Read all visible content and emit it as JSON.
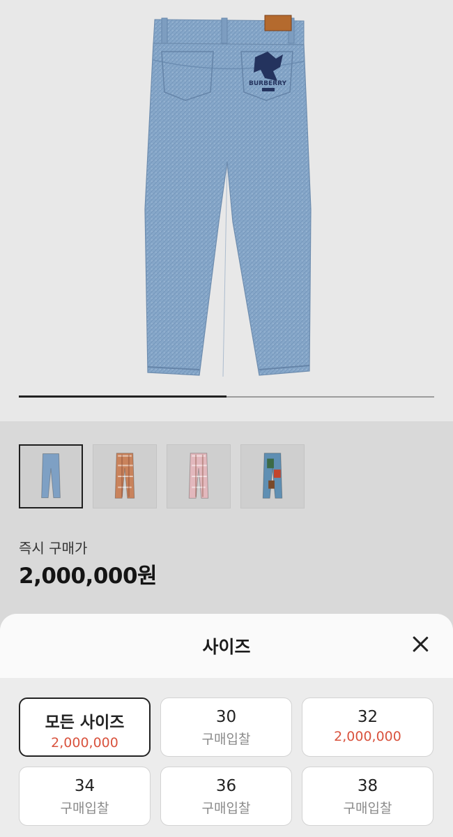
{
  "product": {
    "brand_mark": "BURBERRY",
    "hero_progress": 0.5
  },
  "gallery": {
    "thumbnails": [
      {
        "name": "thumb-blue-denim",
        "color": "#7ea0c4",
        "selected": true
      },
      {
        "name": "thumb-plaid-orange",
        "color": "#c9835c",
        "selected": false
      },
      {
        "name": "thumb-plaid-pink",
        "color": "#e2b8bd",
        "selected": false
      },
      {
        "name": "thumb-patchwork",
        "color": "#5f8fb3",
        "selected": false
      }
    ]
  },
  "price": {
    "label": "즉시 구매가",
    "value": "2,000,000원"
  },
  "sheet": {
    "title": "사이즈",
    "close_icon": "close-icon",
    "sizes": [
      {
        "name": "모든 사이즈",
        "price": "2,000,000",
        "selected": true,
        "accent": true
      },
      {
        "name": "30",
        "price": "구매입찰",
        "selected": false,
        "accent": false
      },
      {
        "name": "32",
        "price": "2,000,000",
        "selected": false,
        "accent": true
      },
      {
        "name": "34",
        "price": "구매입찰",
        "selected": false,
        "accent": false
      },
      {
        "name": "36",
        "price": "구매입찰",
        "selected": false,
        "accent": false
      },
      {
        "name": "38",
        "price": "구매입찰",
        "selected": false,
        "accent": false
      }
    ]
  },
  "colors": {
    "accent_red": "#d9533e",
    "denim": "#84a6c9"
  }
}
